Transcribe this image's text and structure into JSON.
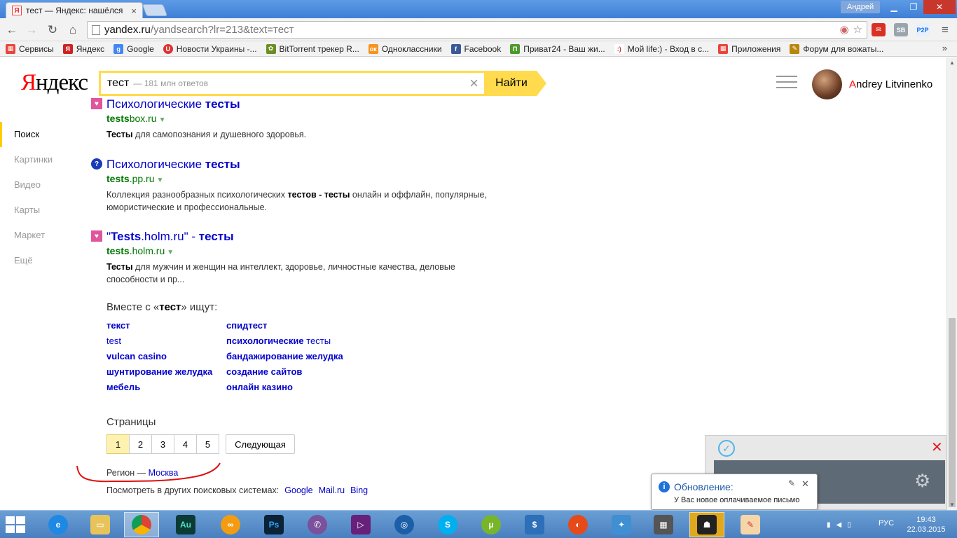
{
  "browser": {
    "tab_title": "тест — Яндекс: нашёлся",
    "tab_favicon": "Я",
    "user": "Андрей",
    "url_host": "yandex.ru",
    "url_path": "/yandsearch?lr=213&text=тест"
  },
  "bookmarks": [
    {
      "label": "Сервисы",
      "icon": "apps-grid-icon",
      "color": "#e8453c"
    },
    {
      "label": "Яндекс",
      "icon": "yandex-icon",
      "color": "#cc2222"
    },
    {
      "label": "Google",
      "icon": "google-icon",
      "color": "#4285f4"
    },
    {
      "label": "Новости Украины -...",
      "icon": "news-icon",
      "color": "#d33"
    },
    {
      "label": "BitTorrent трекер R...",
      "icon": "torrent-icon",
      "color": "#6b8e23"
    },
    {
      "label": "Одноклассники",
      "icon": "odnoklassniki-icon",
      "color": "#f7931e"
    },
    {
      "label": "Facebook",
      "icon": "facebook-icon",
      "color": "#3b5998"
    },
    {
      "label": "Приват24 - Ваш жи...",
      "icon": "privat24-icon",
      "color": "#4c9a2a"
    },
    {
      "label": "Мой life:) - Вход в с...",
      "icon": "life-icon",
      "color": "#c33"
    },
    {
      "label": "Приложения",
      "icon": "apps-grid-icon",
      "color": "#e8453c"
    },
    {
      "label": "Форум для вожаты...",
      "icon": "forum-icon",
      "color": "#b8860b"
    }
  ],
  "yandex": {
    "logo": "Яндекс",
    "search_value": "тест",
    "search_hint": "— 181 млн ответов",
    "search_button": "Найти",
    "user_name_first": "A",
    "user_name_rest": "ndrey Litvinenko"
  },
  "left_nav": [
    "Поиск",
    "Картинки",
    "Видео",
    "Карты",
    "Маркет",
    "Ещё"
  ],
  "results": [
    {
      "title_html": "Психологические <b>тесты</b>",
      "url_bold": "tests",
      "url_rest": "box.ru",
      "snippet_html": "<b>Тесты</b> для самопознания и душевного здоровья.",
      "icon_color": "#e0559c"
    },
    {
      "title_html": "Психологические <b>тесты</b>",
      "url_bold": "tests",
      "url_rest": ".pp.ru",
      "snippet_html": "Коллекция разнообразных психологических <b>тестов - тесты</b> онлайн и оффлайн, популярные, юмористические и профессиональные.",
      "icon_color": "#1a3bb8"
    },
    {
      "title_html": "\"<b>Tests</b>.holm.ru\" - <b>тесты</b>",
      "url_bold": "tests",
      "url_rest": ".holm.ru",
      "snippet_html": "<b>Тесты</b> для мужчин и женщин на интеллект, здоровье, личностные качества, деловые способности и пр...",
      "icon_color": "#e0559c"
    }
  ],
  "related": {
    "prefix": "Вместе с «",
    "query": "тест",
    "suffix": "» ищут:",
    "left": [
      "текст",
      "test",
      "vulcan casino",
      "шунтирование желудка",
      "мебель"
    ],
    "right": [
      "спидтест",
      "психологические тесты",
      "бандажирование желудка",
      "создание сайтов",
      "онлайн казино"
    ]
  },
  "pagination": {
    "title": "Страницы",
    "pages": [
      "1",
      "2",
      "3",
      "4",
      "5"
    ],
    "current": "1",
    "next": "Следующая"
  },
  "footer": {
    "region_label": "Регион —",
    "region_value": "Москва",
    "other_label": "Посмотреть в других поисковых системах:",
    "engines": [
      "Google",
      "Mail.ru",
      "Bing"
    ]
  },
  "notification": {
    "title": "Обновление:",
    "text": "У Вас новое оплачиваемое письмо"
  },
  "taskbar": {
    "lang": "РУС",
    "time": "19:43",
    "date": "22.03.2015"
  }
}
